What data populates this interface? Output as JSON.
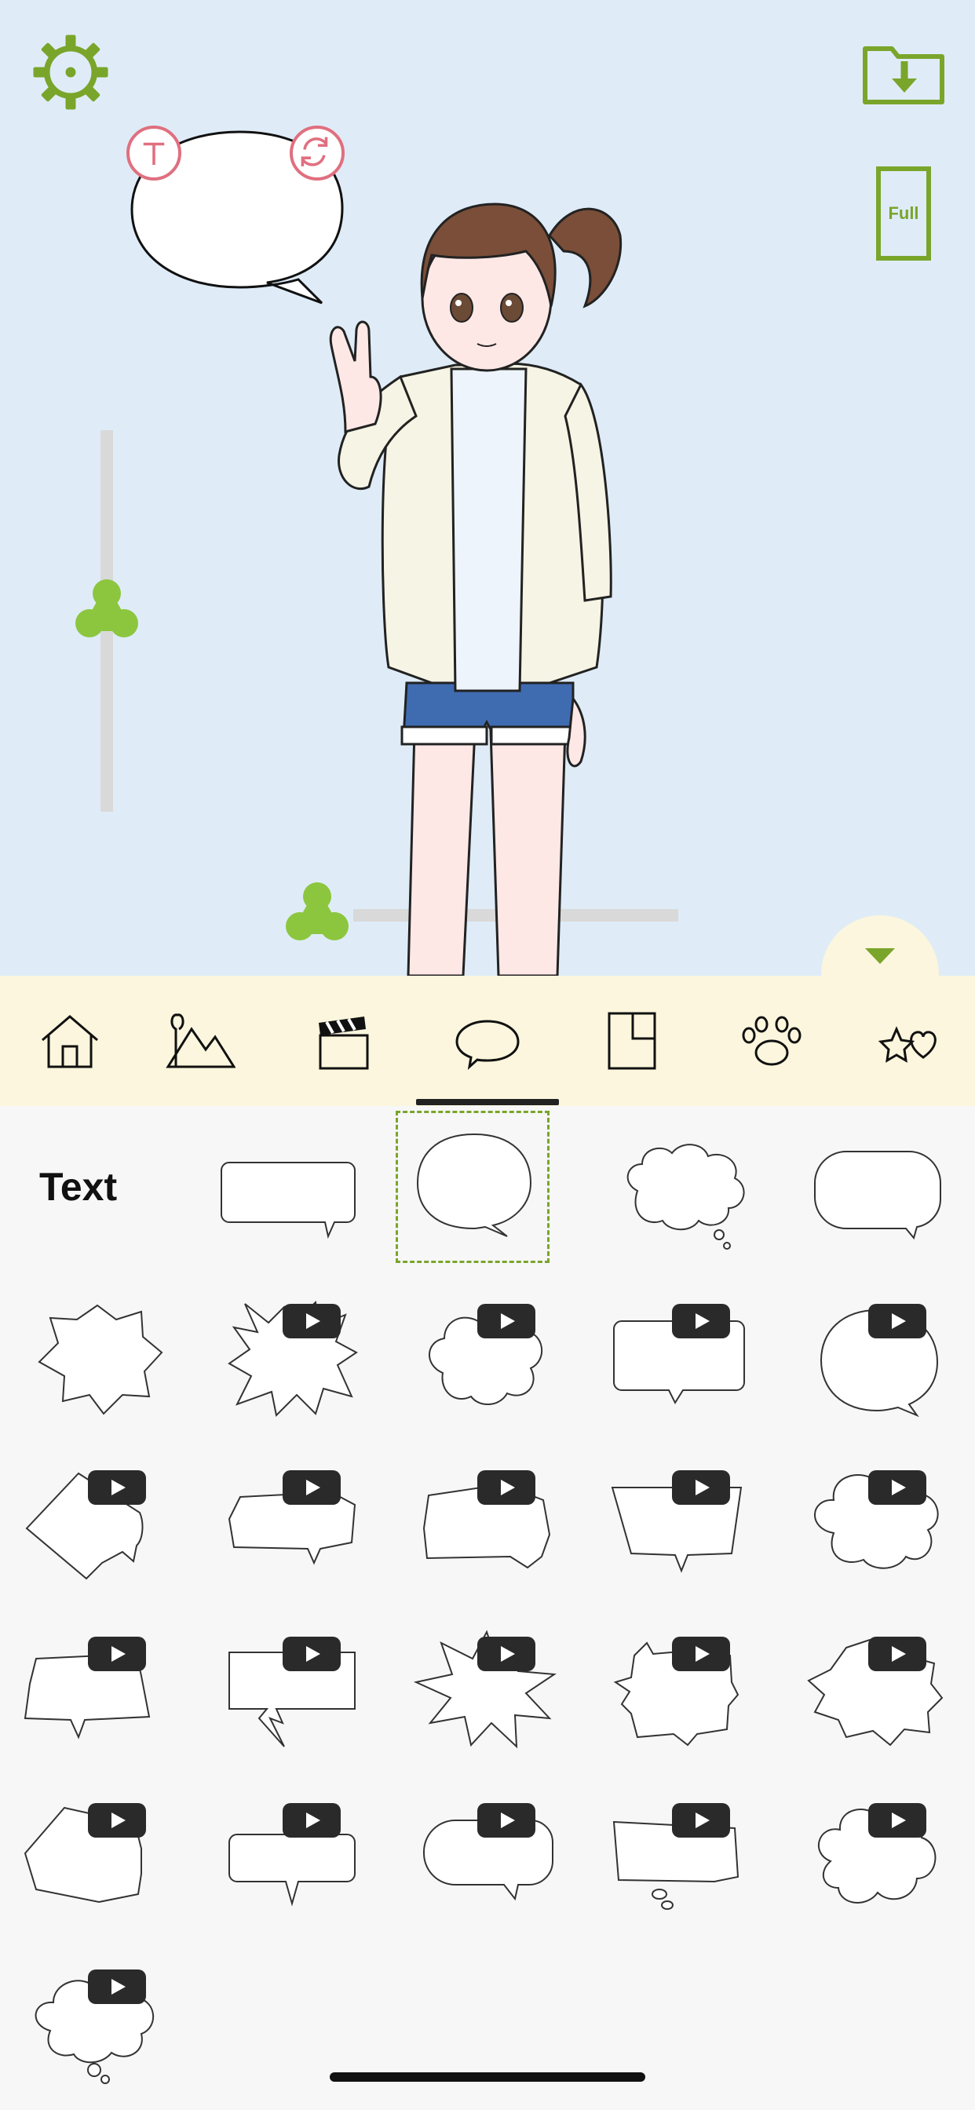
{
  "canvas": {
    "background": "#dfecf8",
    "full_button_label": "Full",
    "speech_bubble_text": ""
  },
  "colors": {
    "accent_green": "#7aa52b",
    "handle_green": "#8cc63f",
    "tab_bar_bg": "#fbf6dd",
    "pink": "#e06f7f"
  },
  "tabs": [
    {
      "name": "home",
      "icon": "home-icon"
    },
    {
      "name": "background",
      "icon": "mountains-icon"
    },
    {
      "name": "scene",
      "icon": "clapperboard-icon"
    },
    {
      "name": "speech-bubbles",
      "icon": "speech-bubble-icon",
      "active": true
    },
    {
      "name": "panels",
      "icon": "panel-layout-icon"
    },
    {
      "name": "stamps",
      "icon": "paw-icon"
    },
    {
      "name": "effects",
      "icon": "star-heart-icon"
    }
  ],
  "bubble_grid": {
    "text_item_label": "Text"
  }
}
